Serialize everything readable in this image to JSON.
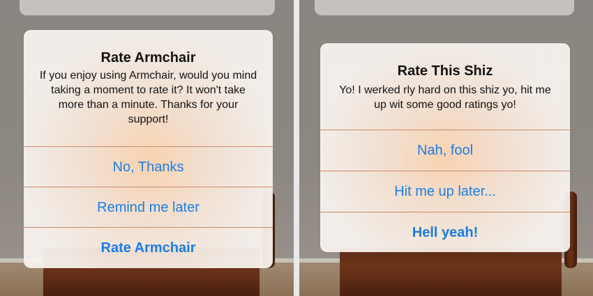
{
  "left_alert": {
    "title": "Rate Armchair",
    "message": "If you enjoy using Armchair, would you mind taking a moment to rate it? It won't take more than a minute. Thanks for your support!",
    "buttons": [
      "No, Thanks",
      "Remind me later",
      "Rate Armchair"
    ]
  },
  "right_alert": {
    "title": "Rate This Shiz",
    "message": "Yo! I werked rly hard on this shiz yo, hit me up wit some good ratings yo!",
    "buttons": [
      "Nah, fool",
      "Hit me up later...",
      "Hell yeah!"
    ]
  },
  "colors": {
    "button_text": "#1a7de6",
    "separator": "#c88a66"
  }
}
